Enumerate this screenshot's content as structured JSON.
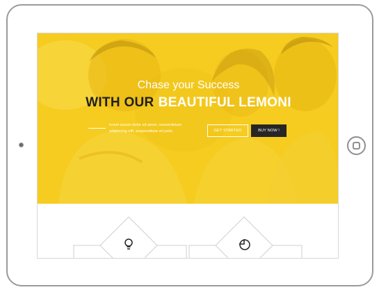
{
  "hero": {
    "subtitle": "Chase your Success",
    "headline_dark": "WITH OUR",
    "headline_light": "BEAUTIFUL LEMONI",
    "description": "lorem ipsum dolor sit amet, consectetuer adipiscing elit. suspendisse et justo."
  },
  "buttons": {
    "get_started": "GET STARTED",
    "buy_now": "BUY NOW !"
  },
  "features": {
    "icons": [
      "lightbulb-icon",
      "pie-chart-icon"
    ]
  },
  "colors": {
    "accent": "#f5cc1f",
    "dark": "#262626"
  }
}
